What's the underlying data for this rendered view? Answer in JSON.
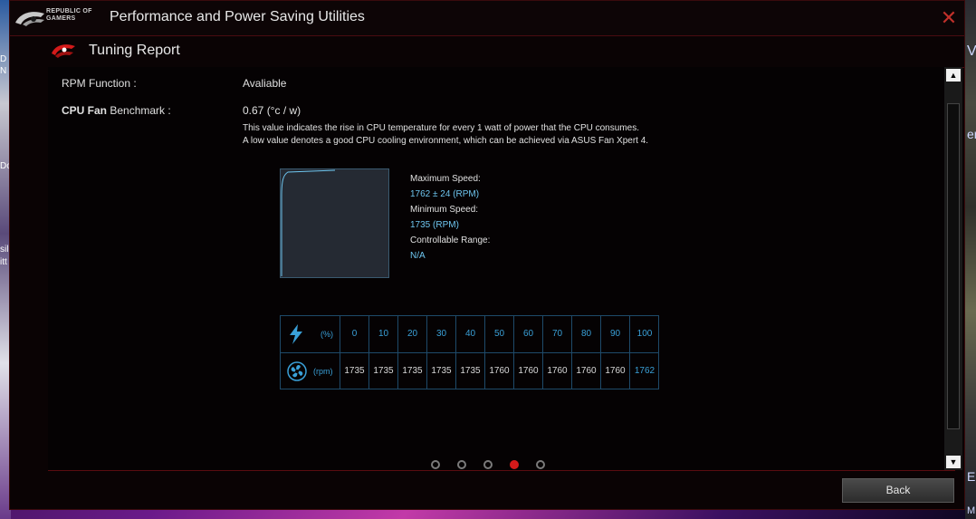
{
  "window": {
    "brand_text": "REPUBLIC OF GAMERS",
    "title": "Performance and Power Saving Utilities",
    "close_glyph": "✕"
  },
  "report": {
    "title": "Tuning Report"
  },
  "rpm_function": {
    "label": "RPM Function :",
    "value": "Avaliable"
  },
  "benchmark": {
    "label_bold": "CPU Fan",
    "label_rest": " Benchmark :",
    "value": "0.67 (°c / w)",
    "desc_line1": "This value indicates the rise in CPU temperature for every 1 watt of power that the CPU consumes.",
    "desc_line2": "A low value denotes a good CPU cooling environment, which can be achieved via ASUS Fan Xpert 4."
  },
  "speed": {
    "max_label": "Maximum Speed:",
    "max_value": "1762 ± 24 (RPM)",
    "min_label": "Minimum Speed:",
    "min_value": "1735 (RPM)",
    "range_label": "Controllable Range:",
    "range_value": "N/A"
  },
  "table": {
    "pct_unit": "(%)",
    "rpm_unit": "(rpm)",
    "percentages": [
      "0",
      "10",
      "20",
      "30",
      "40",
      "50",
      "60",
      "70",
      "80",
      "90",
      "100"
    ],
    "rpms": [
      "1735",
      "1735",
      "1735",
      "1735",
      "1735",
      "1760",
      "1760",
      "1760",
      "1760",
      "1760",
      "1762"
    ],
    "highlight_index": 10
  },
  "pagination": {
    "count": 5,
    "active_index": 3
  },
  "footer": {
    "back_label": "Back"
  },
  "desktop": {
    "left_texts": [
      "D",
      "N",
      "Do",
      "sil",
      "itt"
    ],
    "right_texts": [
      "V",
      "er",
      "E",
      "M"
    ]
  },
  "colors": {
    "accent_red": "#d41a1a",
    "accent_blue": "#3aa0d8",
    "light_blue": "#6ec6f0"
  }
}
